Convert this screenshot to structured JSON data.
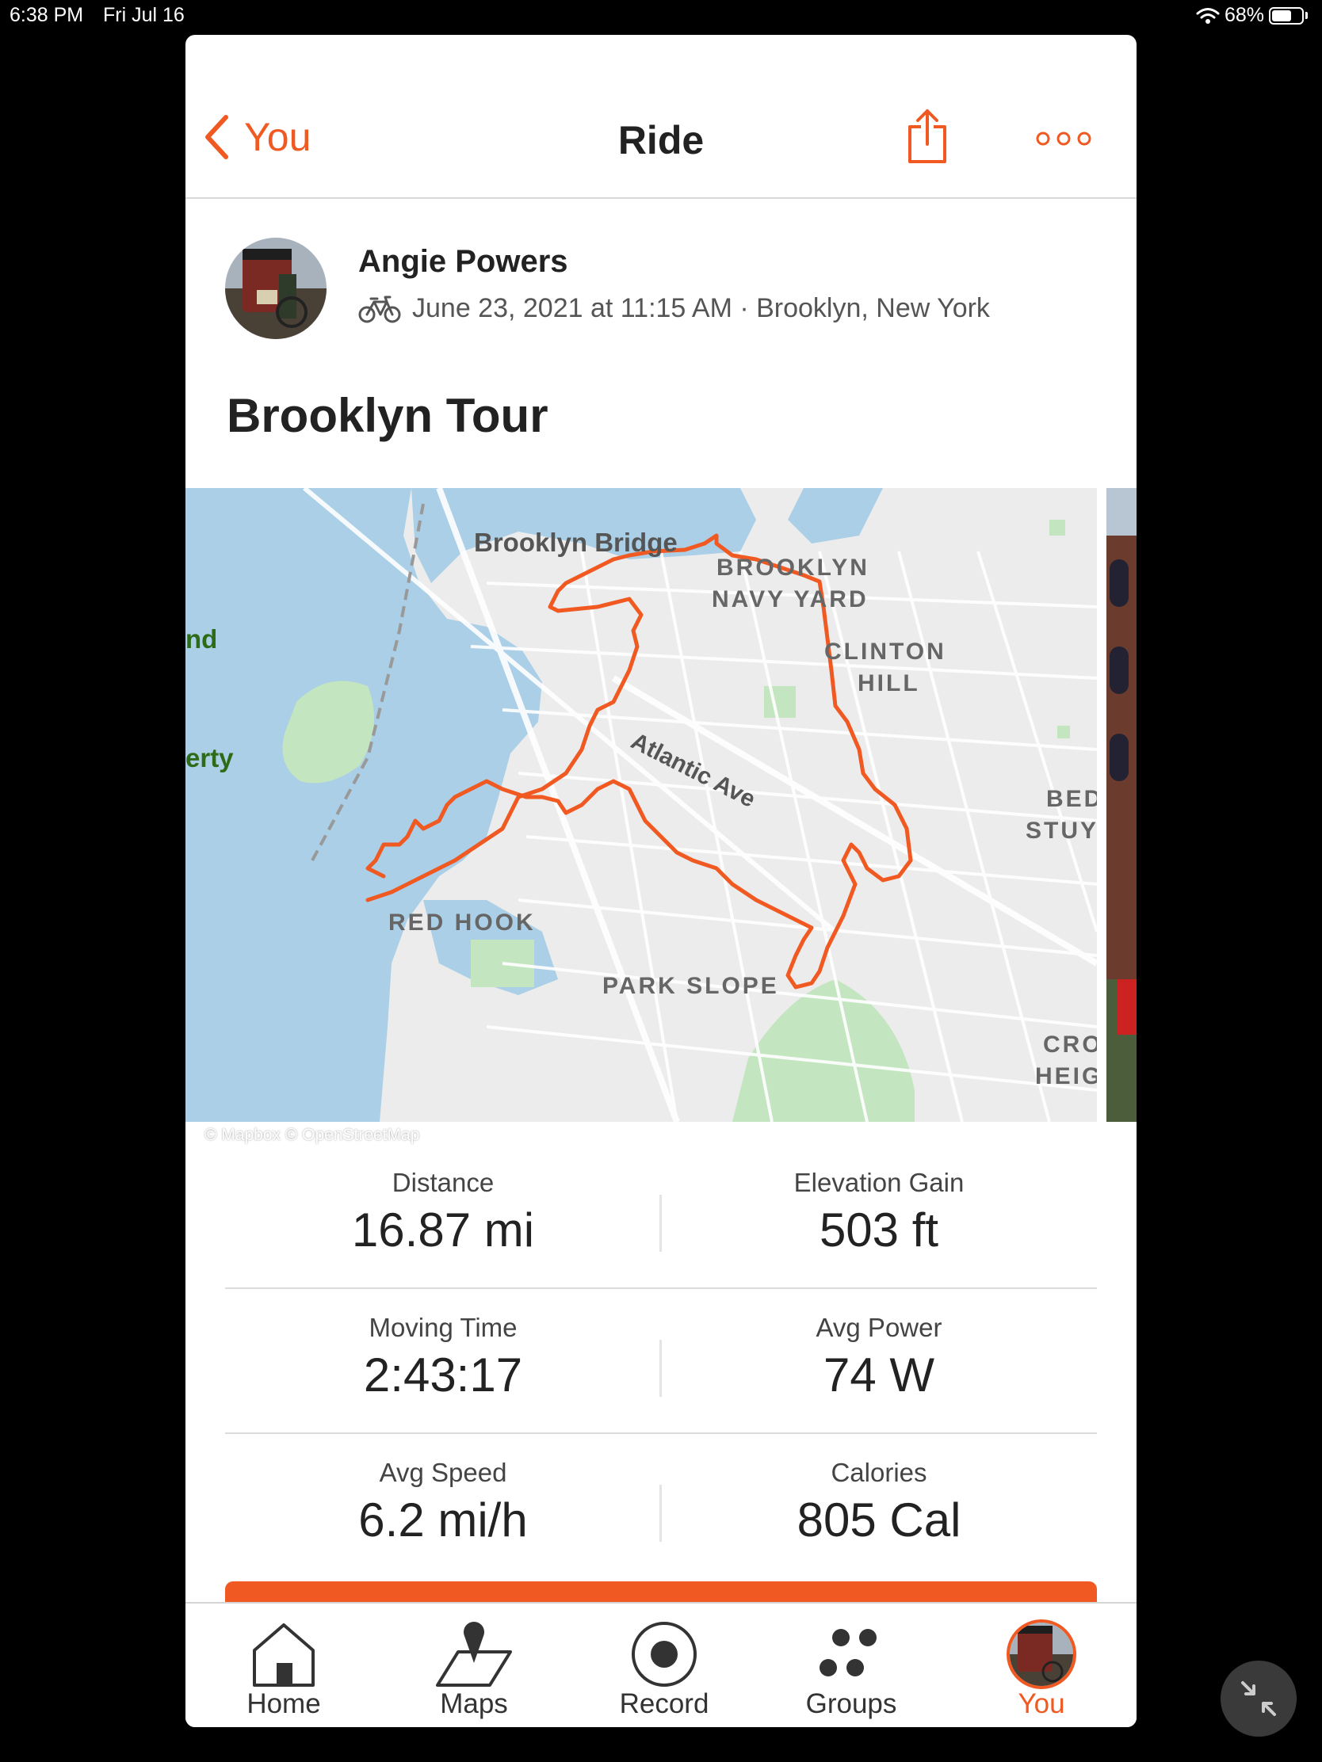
{
  "status_bar": {
    "time": "6:38 PM",
    "date": "Fri Jul 16",
    "battery_text": "68%",
    "battery_level": 0.68
  },
  "nav": {
    "back_label": "You",
    "title": "Ride",
    "share_icon": "share-icon",
    "more_icon": "more-icon"
  },
  "athlete": {
    "name": "Angie Powers",
    "activity_icon": "bike-icon",
    "meta": "June 23, 2021 at 11:15 AM · Brooklyn, New York"
  },
  "activity": {
    "title": "Brooklyn Tour"
  },
  "map": {
    "labels": {
      "brooklyn_bridge": "Brooklyn Bridge",
      "navy_yard_1": "BROOKLYN",
      "navy_yard_2": "NAVY YARD",
      "clinton_hill_1": "CLINTON",
      "clinton_hill_2": "HILL",
      "atlantic_ave": "Atlantic Ave",
      "bed_stuy_1": "BED",
      "bed_stuy_2": "STUY",
      "red_hook": "RED HOOK",
      "park_slope": "PARK SLOPE",
      "crown_heights_1": "CRO",
      "crown_heights_2": "HEIG",
      "edge_nd": "nd",
      "edge_erty": "erty"
    },
    "attribution": "© Mapbox © OpenStreetMap",
    "route_color": "#f05a22"
  },
  "stats": [
    {
      "label": "Distance",
      "value": "16.87 mi"
    },
    {
      "label": "Elevation Gain",
      "value": "503 ft"
    },
    {
      "label": "Moving Time",
      "value": "2:43:17"
    },
    {
      "label": "Avg Power",
      "value": "74 W"
    },
    {
      "label": "Avg Speed",
      "value": "6.2 mi/h"
    },
    {
      "label": "Calories",
      "value": "805 Cal"
    }
  ],
  "tabs": [
    {
      "label": "Home",
      "icon": "home-icon"
    },
    {
      "label": "Maps",
      "icon": "map-pin-icon"
    },
    {
      "label": "Record",
      "icon": "record-icon"
    },
    {
      "label": "Groups",
      "icon": "groups-icon"
    },
    {
      "label": "You",
      "icon": "avatar",
      "active": true
    }
  ],
  "colors": {
    "accent": "#f05a22",
    "water": "#aacfe6",
    "land": "#ececec",
    "park": "#c3e6c0"
  }
}
